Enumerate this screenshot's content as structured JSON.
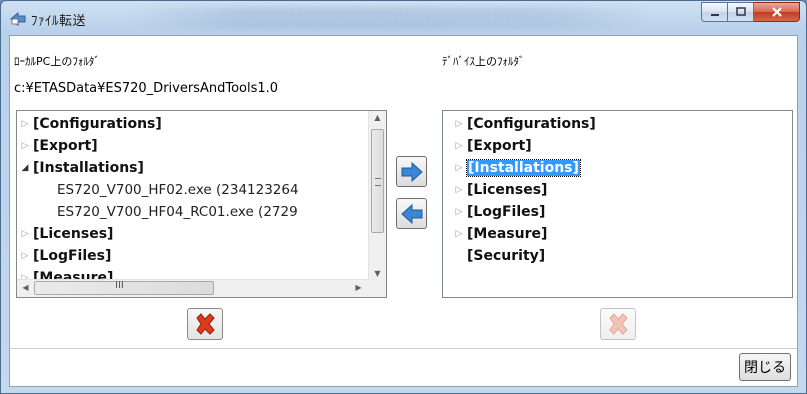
{
  "window": {
    "title": "ﾌｧｲﾙ転送",
    "controls": {
      "minimize": "minimize",
      "maximize": "maximize",
      "close": "close"
    }
  },
  "local": {
    "label": "ﾛｰｶﾙPC上のﾌｫﾙﾀﾞ",
    "path": "c:¥ETASData¥ES720_DriversAndTools1.0",
    "items": [
      {
        "label": "[Configurations]",
        "kind": "folder",
        "expanded": false
      },
      {
        "label": "[Export]",
        "kind": "folder",
        "expanded": false
      },
      {
        "label": "[Installations]",
        "kind": "folder",
        "expanded": true
      },
      {
        "label": "ES720_V700_HF02.exe (234123264",
        "kind": "file"
      },
      {
        "label": "ES720_V700_HF04_RC01.exe (2729",
        "kind": "file"
      },
      {
        "label": "[Licenses]",
        "kind": "folder",
        "expanded": false
      },
      {
        "label": "[LogFiles]",
        "kind": "folder",
        "expanded": false
      },
      {
        "label": "[Measure]",
        "kind": "folder",
        "expanded": false
      }
    ],
    "hscroll_grip": "III"
  },
  "device": {
    "label": "ﾃﾞﾊﾞｲｽ上のﾌｫﾙﾀﾞ",
    "items": [
      {
        "label": "[Configurations]",
        "kind": "folder"
      },
      {
        "label": "[Export]",
        "kind": "folder"
      },
      {
        "label": "[Installations]",
        "kind": "folder",
        "selected": true
      },
      {
        "label": "[Licenses]",
        "kind": "folder"
      },
      {
        "label": "[LogFiles]",
        "kind": "folder"
      },
      {
        "label": "[Measure]",
        "kind": "folder"
      },
      {
        "label": "[Security]",
        "kind": "folder-noexpand"
      }
    ]
  },
  "buttons": {
    "close_label": "閉じる"
  },
  "colors": {
    "transfer_arrow": "#3a86d4",
    "delete_red": "#e03a1c",
    "selection": "#3399ff"
  }
}
